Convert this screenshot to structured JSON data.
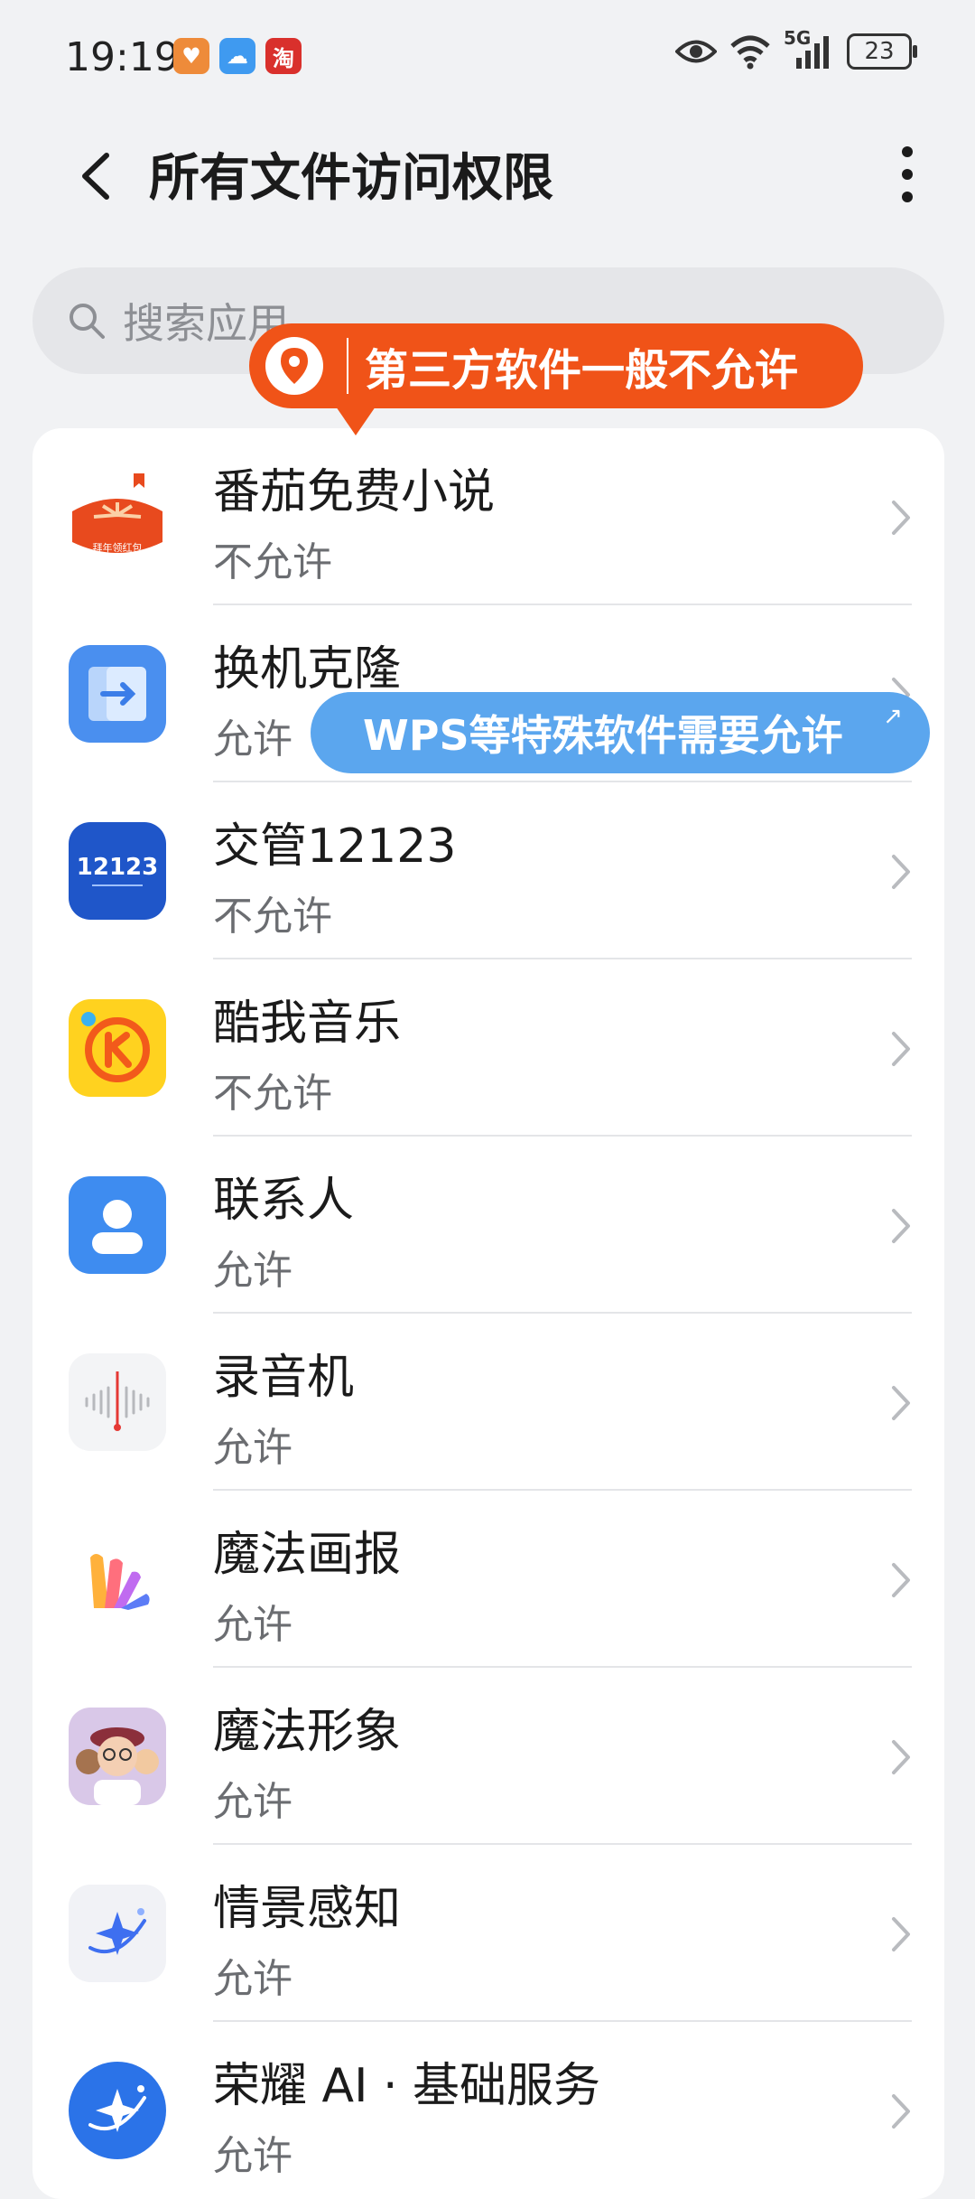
{
  "status_bar": {
    "time": "19:19",
    "notif_icons": [
      "heart-app-icon",
      "weather-icon",
      "taobao-icon"
    ],
    "notif_glyphs": [
      "♥",
      "☁",
      "淘"
    ],
    "network": "5G",
    "battery": "23"
  },
  "header": {
    "title": "所有文件访问权限"
  },
  "search": {
    "placeholder": "搜索应用"
  },
  "overlays": {
    "orange_tip": "第三方软件一般不允许",
    "blue_tip": "WPS等特殊软件需要允许",
    "blue_tip_arrow": "↗"
  },
  "apps": [
    {
      "name": "番茄免费小说",
      "status": "不允许",
      "icon": "fanqie-novel-icon",
      "badge": "拜年领红包"
    },
    {
      "name": "换机克隆",
      "status": "允许",
      "icon": "phone-clone-icon"
    },
    {
      "name": "交管12123",
      "status": "不允许",
      "icon": "traffic-12123-icon",
      "badge": "12123"
    },
    {
      "name": "酷我音乐",
      "status": "不允许",
      "icon": "kuwo-music-icon"
    },
    {
      "name": "联系人",
      "status": "允许",
      "icon": "contacts-icon"
    },
    {
      "name": "录音机",
      "status": "允许",
      "icon": "recorder-icon"
    },
    {
      "name": "魔法画报",
      "status": "允许",
      "icon": "magic-pictorial-icon"
    },
    {
      "name": "魔法形象",
      "status": "允许",
      "icon": "magic-avatar-icon"
    },
    {
      "name": "情景感知",
      "status": "允许",
      "icon": "scene-awareness-icon"
    },
    {
      "name": "荣耀 AI · 基础服务",
      "status": "允许",
      "icon": "honor-ai-icon"
    }
  ],
  "colors": {
    "accent_orange": "#f05318",
    "accent_blue": "#5ba6ee",
    "background": "#f1f2f4"
  }
}
